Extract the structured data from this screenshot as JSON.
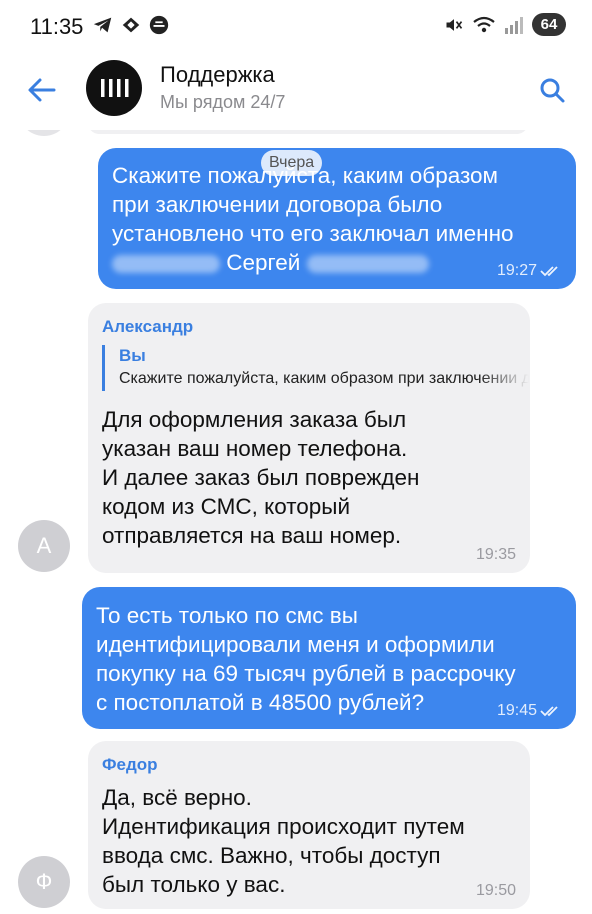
{
  "status_bar": {
    "time": "11:35",
    "battery": "64",
    "left_icons": [
      "telegram-icon",
      "ride-app-icon",
      "speed-app-icon"
    ],
    "right_icons": [
      "mute-icon",
      "wifi-icon",
      "signal-icon",
      "battery-icon"
    ]
  },
  "header": {
    "title": "Поддержка",
    "subtitle": "Мы рядом 24/7",
    "accent_color": "#3a7fe0"
  },
  "date_chip": "Вчера",
  "messages": [
    {
      "direction": "outgoing",
      "lines": [
        "Скажите пожалуйста, каким образом",
        "при заключении договора было",
        "установлено что его заключал именно"
      ],
      "last_line_visible": "Сергей",
      "time": "19:27",
      "status": "read"
    },
    {
      "direction": "incoming",
      "sender": "Александр",
      "avatar_letter": "А",
      "reply": {
        "author": "Вы",
        "text": "Скажите пожалуйста, каким образом при заключении договора было"
      },
      "lines": [
        "Для оформления заказа был",
        "указан ваш номер телефона.",
        "И далее заказ был поврежден",
        "кодом из СМС, который",
        "отправляется на ваш номер."
      ],
      "time": "19:35"
    },
    {
      "direction": "outgoing",
      "lines": [
        "То есть только по смс вы",
        "идентифицировали меня и оформили",
        "покупку на 69 тысяч рублей в рассрочку",
        "с постоплатой в 48500 рублей?"
      ],
      "time": "19:45",
      "status": "read"
    },
    {
      "direction": "incoming",
      "sender": "Федор",
      "avatar_letter": "Ф",
      "lines": [
        "Да, всё верно.",
        "Идентификация происходит путем",
        "ввода смс. Важно, чтобы доступ",
        "был только у вас."
      ],
      "time": "19:50"
    }
  ],
  "colors": {
    "outgoing_bubble": "#3d86ee",
    "incoming_bubble": "#f0f0f2",
    "sender_name": "#3a7fe0"
  }
}
